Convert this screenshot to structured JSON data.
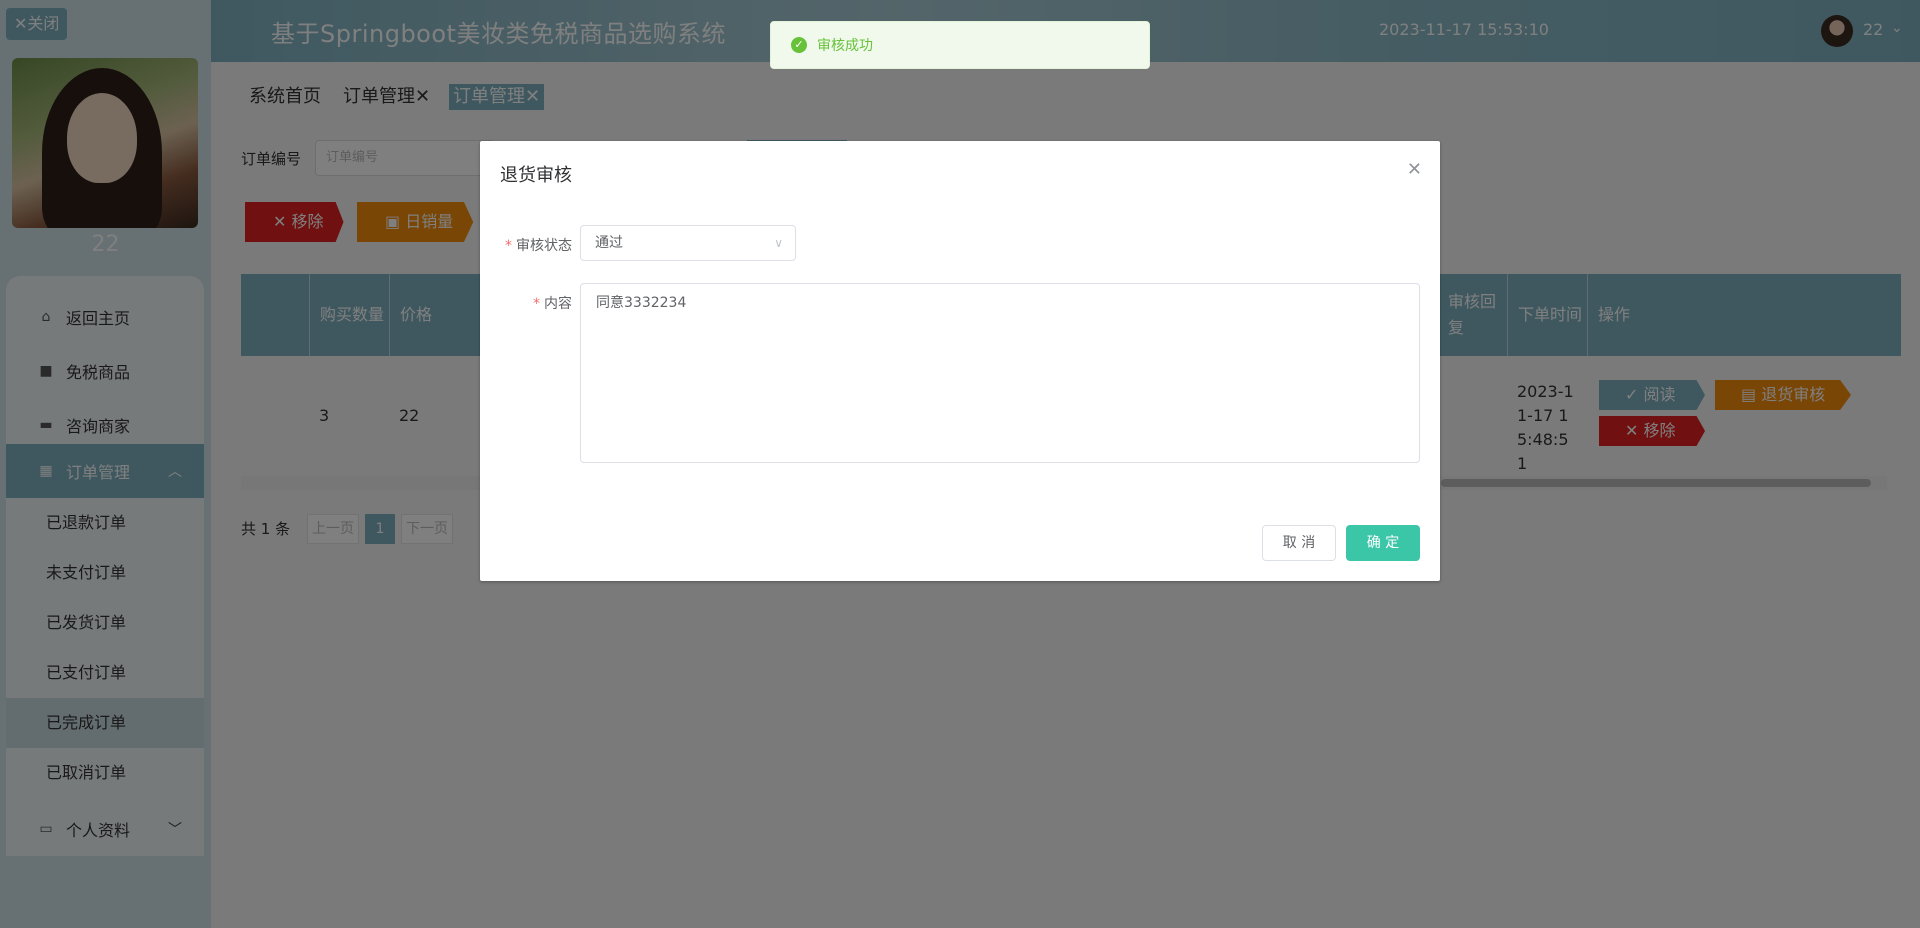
{
  "sidebar": {
    "close_label": "✕关闭",
    "user_name": "22",
    "menu": [
      {
        "label": "返回主页",
        "icon": "home-icon"
      },
      {
        "label": "免税商品",
        "icon": "bag-icon"
      },
      {
        "label": "咨询商家",
        "icon": "ticket-icon"
      },
      {
        "label": "订单管理",
        "icon": "grid-icon"
      },
      {
        "label": "个人资料",
        "icon": "card-icon"
      }
    ],
    "order_submenu": [
      "已退款订单",
      "未支付订单",
      "已发货订单",
      "已支付订单",
      "已完成订单",
      "已取消订单"
    ]
  },
  "header": {
    "title": "基于Springboot美妆类免税商品选购系统",
    "datetime": "2023-11-17 15:53:10",
    "user": "22"
  },
  "tabs": [
    "系统首页",
    "订单管理✕",
    "订单管理✕"
  ],
  "search": {
    "label": "订单编号",
    "placeholder": "订单编号"
  },
  "actions": {
    "remove": "移除",
    "daily_sales": "日销量"
  },
  "table": {
    "headers": [
      "购买数量",
      "价格",
      "审核回复",
      "下单时间",
      "操作"
    ],
    "row": {
      "quantity": "3",
      "price": "22",
      "order_time": "2023-11-17 15:48:51",
      "op_read": "阅读",
      "op_return_review": "退货审核",
      "op_remove": "移除"
    }
  },
  "pagination": {
    "total": "共 1 条",
    "prev": "上一页",
    "page": "1",
    "next": "下一页"
  },
  "toast": {
    "message": "审核成功"
  },
  "dialog": {
    "title": "退货审核",
    "status_label": "审核状态",
    "status_value": "通过",
    "content_label": "内容",
    "content_value": "同意3332234",
    "cancel": "取 消",
    "confirm": "确 定"
  },
  "colors": {
    "primary": "#7fb1c0",
    "danger": "#e02020",
    "warning": "#f28c0b",
    "confirm": "#3cc6a8",
    "success": "#67c23a"
  }
}
